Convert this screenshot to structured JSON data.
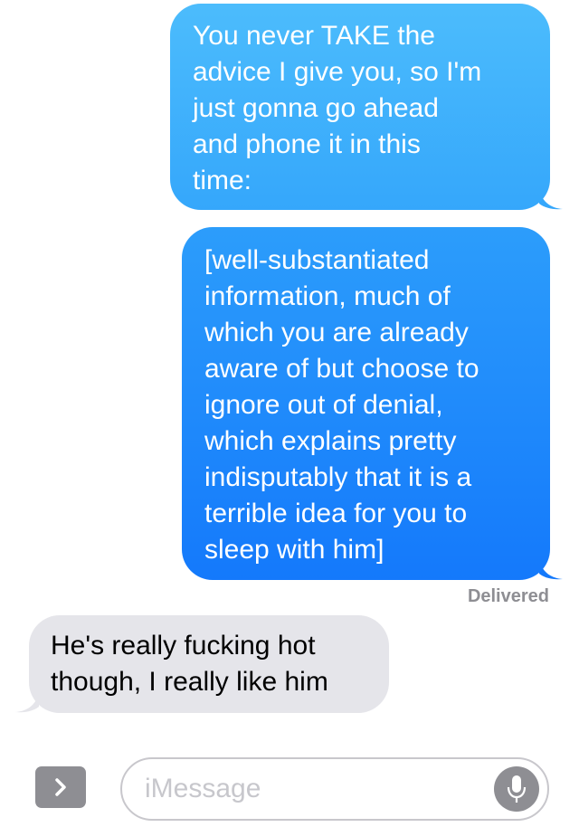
{
  "conversation": {
    "messages": [
      {
        "direction": "sent",
        "text": "You never TAKE the\nadvice I give you, so I'm\njust gonna go ahead\nand phone it in this\ntime:"
      },
      {
        "direction": "sent",
        "text": "[well-substantiated\ninformation, much of\nwhich you are already\naware of but choose to\nignore out of denial,\nwhich explains pretty\nindisputably that it is a\nterrible idea for you to\nsleep with him]"
      },
      {
        "direction": "received",
        "text": "He's really fucking hot\nthough, I really like him"
      }
    ],
    "delivery_status": "Delivered"
  },
  "composer": {
    "placeholder": "iMessage",
    "expand_icon": "chevron-right-icon",
    "mic_icon": "microphone-icon"
  },
  "colors": {
    "sent_bubble_top": "#4cbcfc",
    "sent_bubble_bottom": "#1479fb",
    "received_bubble": "#e5e5ea",
    "secondary_gray": "#8e8e93"
  }
}
